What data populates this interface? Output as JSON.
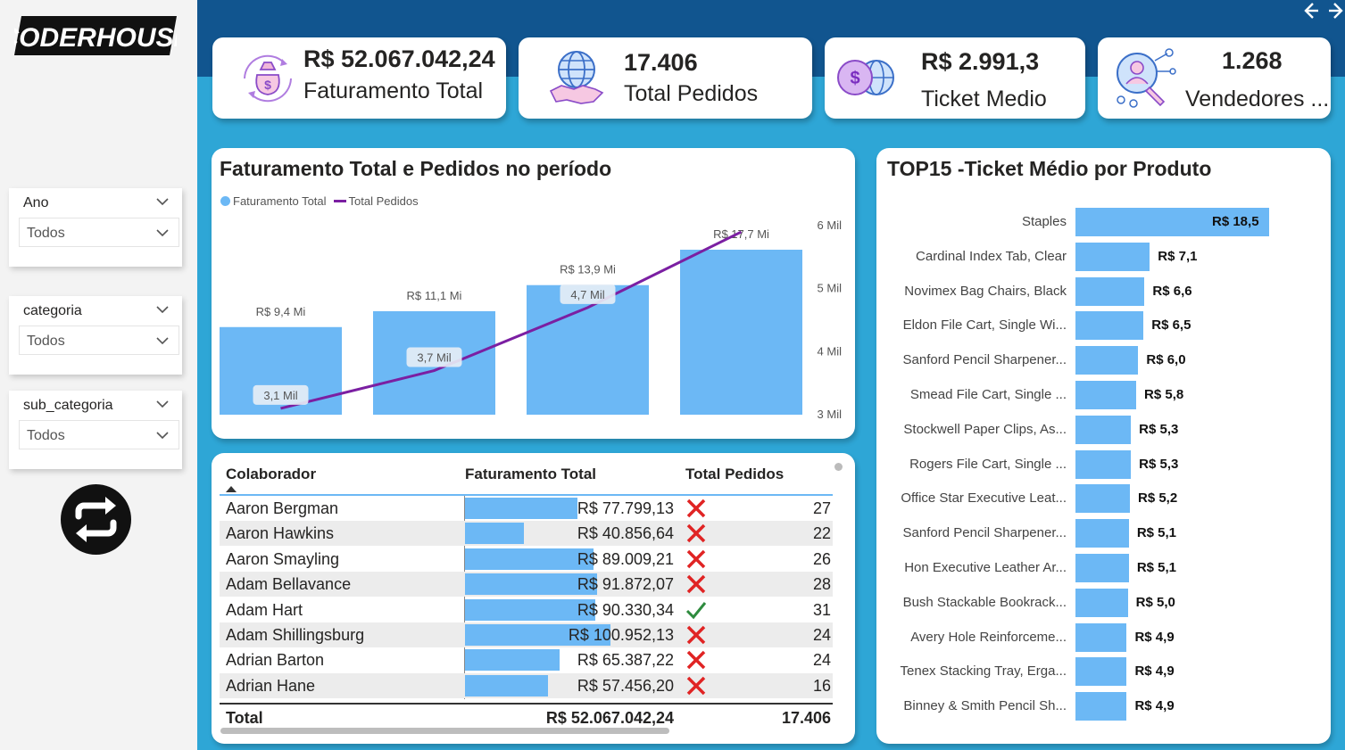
{
  "app": {
    "logo_text": "CODERHOUSE"
  },
  "filters": [
    {
      "title": "Ano",
      "value": "Todos"
    },
    {
      "title": "categoria",
      "value": "Todos"
    },
    {
      "title": "sub_categoria",
      "value": "Todos"
    }
  ],
  "kpis": [
    {
      "value": "R$ 52.067.042,24",
      "label": "Faturamento Total",
      "icon": "money-bag-icon"
    },
    {
      "value": "17.406",
      "label": "Total Pedidos",
      "icon": "globe-handshake-icon"
    },
    {
      "value": "R$ 2.991,3",
      "label": "Ticket Medio",
      "icon": "coin-globe-icon"
    },
    {
      "value": "1.268",
      "label": "Vendedores ...",
      "icon": "user-network-icon"
    }
  ],
  "combo_chart": {
    "title": "Faturamento Total e Pedidos no período",
    "legend": [
      "Faturamento Total",
      "Total Pedidos"
    ],
    "right_axis_ticks": [
      "6 Mil",
      "5 Mil",
      "4 Mil",
      "3 Mil"
    ]
  },
  "chart_data": [
    {
      "type": "bar",
      "title": "Faturamento Total e Pedidos no período",
      "series": [
        {
          "name": "Faturamento Total",
          "values": [
            9.4,
            11.1,
            13.9,
            17.7
          ],
          "labels": [
            "R$ 9,4 Mi",
            "R$ 11,1 Mi",
            "R$ 13,9 Mi",
            "R$ 17,7 Mi"
          ],
          "color": "#6cb8f5",
          "unit": "R$ Mi"
        },
        {
          "name": "Total Pedidos",
          "values": [
            3.1,
            3.7,
            4.7,
            5.9
          ],
          "labels": [
            "3,1 Mil",
            "3,7 Mil",
            "4,7 Mil",
            ""
          ],
          "color": "#7b1fa2",
          "unit": "Mil",
          "axis": "right"
        }
      ],
      "y2_ticks": [
        6,
        5,
        4,
        3
      ],
      "y2lim": [
        3,
        6
      ]
    },
    {
      "type": "bar",
      "title": "TOP15 -Ticket Médio por Produto",
      "orientation": "horizontal",
      "categories": [
        "Staples",
        "Cardinal Index Tab, Clear",
        "Novimex Bag Chairs, Black",
        "Eldon File Cart, Single Wi...",
        "Sanford Pencil Sharpener...",
        "Smead File Cart, Single ...",
        "Stockwell Paper Clips, As...",
        "Rogers File Cart, Single ...",
        "Office Star Executive Leat...",
        "Sanford Pencil Sharpener...",
        "Hon Executive Leather Ar...",
        "Bush Stackable Bookrack...",
        "Avery Hole Reinforceme...",
        "Tenex Stacking Tray, Erga...",
        "Binney & Smith Pencil Sh..."
      ],
      "values": [
        18.5,
        7.1,
        6.6,
        6.5,
        6.0,
        5.8,
        5.3,
        5.3,
        5.2,
        5.1,
        5.1,
        5.0,
        4.9,
        4.9,
        4.9
      ],
      "labels": [
        "R$ 18,5",
        "R$ 7,1",
        "R$ 6,6",
        "R$ 6,5",
        "R$ 6,0",
        "R$ 5,8",
        "R$ 5,3",
        "R$ 5,3",
        "R$ 5,2",
        "R$ 5,1",
        "R$ 5,1",
        "R$ 5,0",
        "R$ 4,9",
        "R$ 4,9",
        "R$ 4,9"
      ],
      "color": "#6cb8f5"
    }
  ],
  "top_chart": {
    "title": "TOP15 -Ticket Médio por Produto"
  },
  "table": {
    "headers": [
      "Colaborador",
      "Faturamento Total",
      "Total Pedidos"
    ],
    "rows": [
      {
        "name": "Aaron Bergman",
        "fat": "R$ 77.799,13",
        "fat_value": 77799.13,
        "status": "cross",
        "ped": "27"
      },
      {
        "name": "Aaron Hawkins",
        "fat": "R$ 40.856,64",
        "fat_value": 40856.64,
        "status": "cross",
        "ped": "22"
      },
      {
        "name": "Aaron Smayling",
        "fat": "R$ 89.009,21",
        "fat_value": 89009.21,
        "status": "cross",
        "ped": "26"
      },
      {
        "name": "Adam Bellavance",
        "fat": "R$ 91.872,07",
        "fat_value": 91872.07,
        "status": "cross",
        "ped": "28"
      },
      {
        "name": "Adam Hart",
        "fat": "R$ 90.330,34",
        "fat_value": 90330.34,
        "status": "check",
        "ped": "31"
      },
      {
        "name": "Adam Shillingsburg",
        "fat": "R$ 100.952,13",
        "fat_value": 100952.13,
        "status": "cross",
        "ped": "24"
      },
      {
        "name": "Adrian Barton",
        "fat": "R$ 65.387,22",
        "fat_value": 65387.22,
        "status": "cross",
        "ped": "24"
      },
      {
        "name": "Adrian Hane",
        "fat": "R$ 57.456,20",
        "fat_value": 57456.2,
        "status": "cross",
        "ped": "16"
      }
    ],
    "total": {
      "label": "Total",
      "fat": "R$ 52.067.042,24",
      "ped": "17.406"
    }
  }
}
